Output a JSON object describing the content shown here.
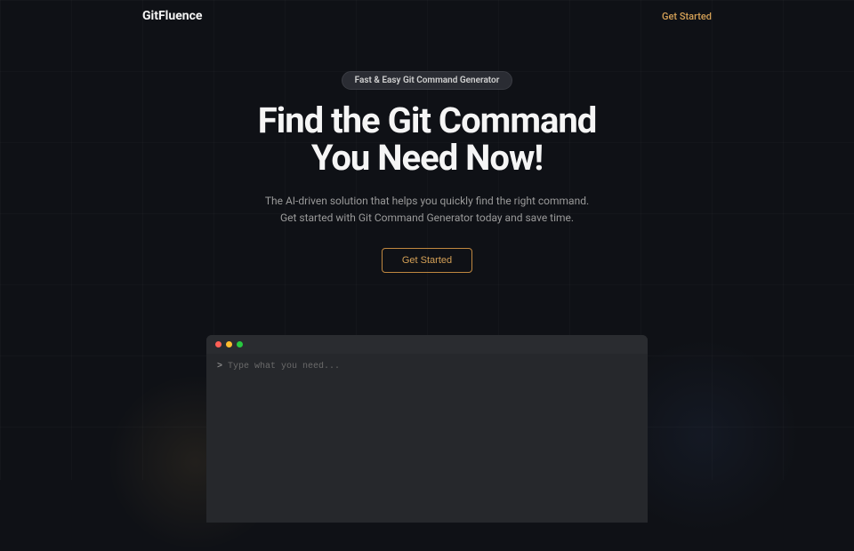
{
  "header": {
    "logo": "GitFluence",
    "nav_get_started": "Get Started"
  },
  "hero": {
    "badge": "Fast & Easy Git Command Generator",
    "title_line1": "Find the Git Command",
    "title_line2": "You Need Now!",
    "subtitle_line1": "The AI-driven solution that helps you quickly find the right command.",
    "subtitle_line2": "Get started with Git Command Generator today and save time.",
    "cta": "Get Started"
  },
  "terminal": {
    "prompt_symbol": ">",
    "placeholder": "Type what you need..."
  }
}
